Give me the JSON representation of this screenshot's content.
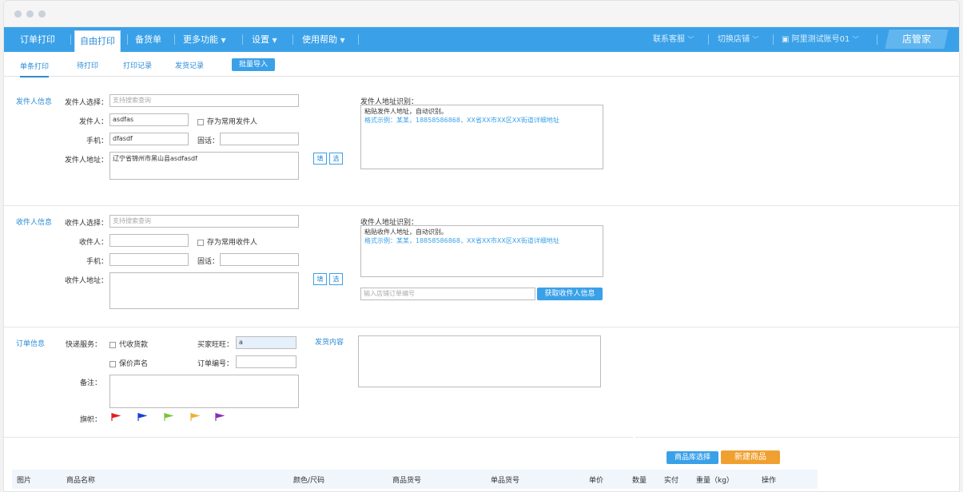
{
  "nav": {
    "items": [
      "订单打印",
      "自由打印",
      "备货单",
      "更多功能",
      "设置",
      "使用帮助"
    ],
    "active_index": 1,
    "right_items": [
      "联系客服",
      "切换店铺",
      "阿里测试账号01"
    ],
    "logo": "店管家"
  },
  "subtabs": [
    "单条打印",
    "待打印",
    "打印记录",
    "发货记录"
  ],
  "batch_import": "批量导入",
  "sender": {
    "section_title": "发件人信息",
    "select_label": "发件人选择：",
    "select_placeholder": "支持搜索查询",
    "name_label": "发件人：",
    "name_value": "asdfas",
    "save_common": "存为常用发件人",
    "phone_label": "手机：",
    "phone_value": "dfasdf",
    "tel_label": "固话：",
    "address_label": "发件人地址：",
    "address_value": "辽宁省锦州市黑山县asdfasdf",
    "ident_title": "发件人地址识别：",
    "ident_hint": "粘贴发件人地址，自动识别。",
    "ident_example": "格式示例：某某，18858586868，XX省XX市XX区XX街道详细地址",
    "fill_btn": "填",
    "select_btn": "选"
  },
  "receiver": {
    "section_title": "收件人信息",
    "select_label": "收件人选择：",
    "select_placeholder": "支持搜索查询",
    "name_label": "收件人：",
    "save_common": "存为常用收件人",
    "phone_label": "手机：",
    "tel_label": "固话：",
    "address_label": "收件人地址：",
    "ident_title": "收件人地址识别：",
    "ident_hint": "粘贴收件人地址，自动识别。",
    "ident_example": "格式示例：某某，18858586868，XX省XX市XX区XX街道详细地址",
    "order_no_placeholder": "输入店铺订单编号",
    "get_info_btn": "获取收件人信息",
    "fill_btn": "填",
    "select_btn": "选"
  },
  "order": {
    "section_title": "订单信息",
    "express_label": "快递服务：",
    "cod": "代收货款",
    "insured": "保价声名",
    "buyer_label": "买家旺旺：",
    "buyer_value": "a",
    "order_no_label": "订单编号：",
    "remark_label": "备注：",
    "flag_label": "旗帜：",
    "ship_content_title": "发货内容",
    "flags": [
      "#e02020",
      "#1a3fd6",
      "#7dc43a",
      "#f0b030",
      "#8a2bb8"
    ]
  },
  "goods": {
    "lib_select_btn": "商品库选择",
    "new_goods_btn": "新建商品",
    "columns": [
      "图片",
      "商品名称",
      "颜色/尺码",
      "商品货号",
      "单品货号",
      "单价",
      "数量",
      "实付",
      "重量（kg）",
      "操作"
    ]
  }
}
